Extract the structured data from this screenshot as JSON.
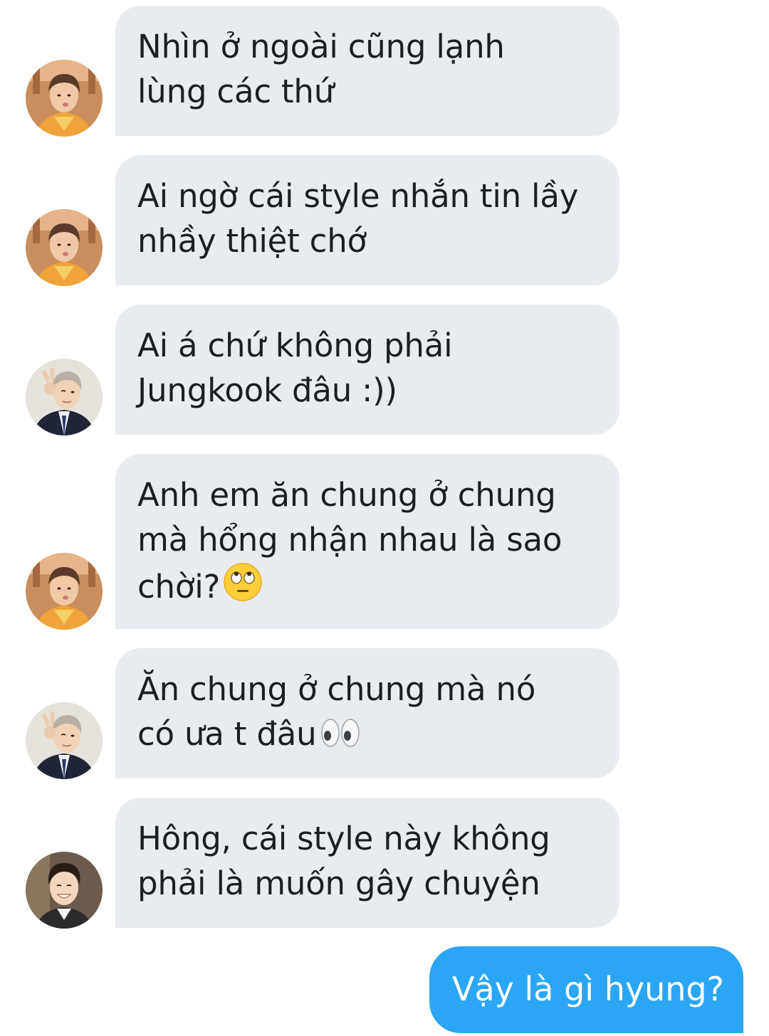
{
  "conversation": {
    "incoming": [
      {
        "sender": "avatar-member-a",
        "text": "Nhìn ở ngoài cũng lạnh\nlùng các thứ"
      },
      {
        "sender": "avatar-member-a",
        "text": "Ai ngờ cái style nhắn tin lầy\nnhầy thiệt chớ"
      },
      {
        "sender": "avatar-member-b",
        "text": "Ai á chứ không phải\nJungkook đâu :))"
      },
      {
        "sender": "avatar-member-a",
        "text": "Anh em ăn chung ở chung\nmà hổng nhận nhau là sao\nchời?",
        "emoji": "face-with-rolling-eyes-emoji"
      },
      {
        "sender": "avatar-member-b",
        "text": "Ăn chung ở chung mà nó\ncó ưa t đâu",
        "emoji": "eyes-emoji"
      },
      {
        "sender": "avatar-member-c",
        "text": "Hông, cái style này không\nphải là muốn gây chuyện"
      }
    ],
    "outgoing": [
      {
        "text": "Vậy là gì hyung?"
      }
    ]
  },
  "colors": {
    "incoming_bubble": "#e8ebef",
    "outgoing_bubble": "#2aa6f5",
    "incoming_text": "#1c1e21",
    "outgoing_text": "#ffffff"
  }
}
